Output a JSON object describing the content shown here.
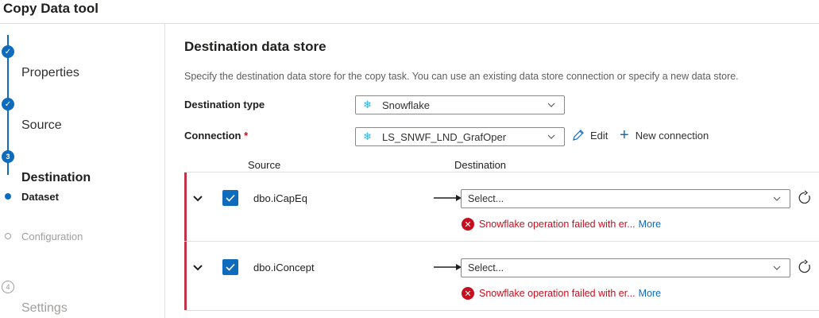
{
  "window": {
    "title": "Copy Data tool"
  },
  "steps": [
    {
      "label": "Properties",
      "state": "done",
      "marker": "✓"
    },
    {
      "label": "Source",
      "state": "done",
      "marker": "✓"
    },
    {
      "label": "Destination",
      "state": "current",
      "marker": "3"
    },
    {
      "label": "Dataset",
      "state": "current-sub"
    },
    {
      "label": "Configuration",
      "state": "pending-sub"
    },
    {
      "label": "Settings",
      "state": "pending",
      "marker": "4"
    }
  ],
  "main": {
    "heading": "Destination data store",
    "description": "Specify the destination data store for the copy task. You can use an existing data store connection or specify a new data store.",
    "destination_type": {
      "label": "Destination type",
      "value": "Snowflake",
      "icon": "snowflake-icon"
    },
    "connection": {
      "label": "Connection",
      "required_mark": "*",
      "value": "LS_SNWF_LND_GrafOper",
      "icon": "snowflake-icon"
    },
    "edit_label": "Edit",
    "new_connection_label": "New connection",
    "columns": {
      "source": "Source",
      "destination": "Destination"
    },
    "mappings": [
      {
        "source": "dbo.iCapEq",
        "checked": true,
        "placeholder": "Select...",
        "error": "Snowflake operation failed with er...",
        "more": "More"
      },
      {
        "source": "dbo.iConcept",
        "checked": true,
        "placeholder": "Select...",
        "error": "Snowflake operation failed with er...",
        "more": "More"
      }
    ]
  },
  "colors": {
    "accent": "#0f6cbd",
    "error": "#c50f1f",
    "error_bar": "#c4314b",
    "snowflake": "#29b5e8"
  }
}
